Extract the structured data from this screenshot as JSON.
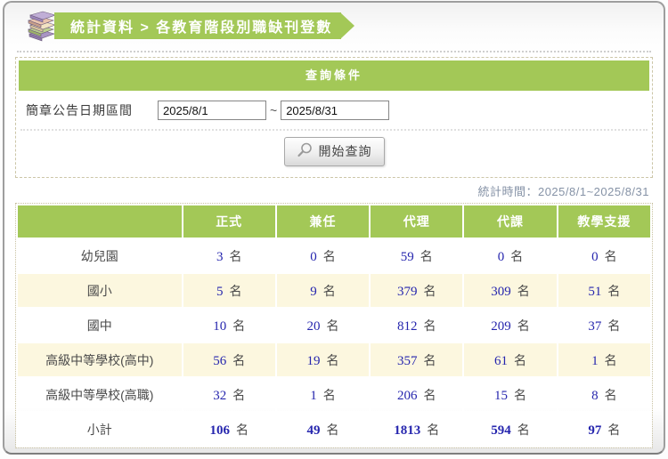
{
  "colors": {
    "green": "#a3c857",
    "cream_row": "#fcf7df",
    "number_blue": "#2626ae",
    "stat_time_gray_blue": "#8592a6"
  },
  "header": {
    "breadcrumb": "統計資料 > 各教育階段別職缺刊登數",
    "icon": "books-stack-icon"
  },
  "query": {
    "panel_title": "查詢條件",
    "date_label": "簡章公告日期區間",
    "date_from": "2025/8/1",
    "date_separator": "~",
    "date_to": "2025/8/31",
    "search_button_label": "開始查詢",
    "search_button_icon": "magnifier-icon"
  },
  "stat_time": "統計時間：2025/8/1~2025/8/31",
  "table": {
    "columns": [
      "正式",
      "兼任",
      "代理",
      "代課",
      "教學支援"
    ],
    "unit": "名",
    "rows": [
      {
        "label": "幼兒園",
        "values": [
          3,
          0,
          59,
          0,
          0
        ]
      },
      {
        "label": "國小",
        "values": [
          5,
          9,
          379,
          309,
          51
        ]
      },
      {
        "label": "國中",
        "values": [
          10,
          20,
          812,
          209,
          37
        ]
      },
      {
        "label": "高級中等學校(高中)",
        "values": [
          56,
          19,
          357,
          61,
          1
        ]
      },
      {
        "label": "高級中等學校(高職)",
        "values": [
          32,
          1,
          206,
          15,
          8
        ]
      },
      {
        "label": "小計",
        "values": [
          106,
          49,
          1813,
          594,
          97
        ],
        "is_total": true
      }
    ]
  }
}
